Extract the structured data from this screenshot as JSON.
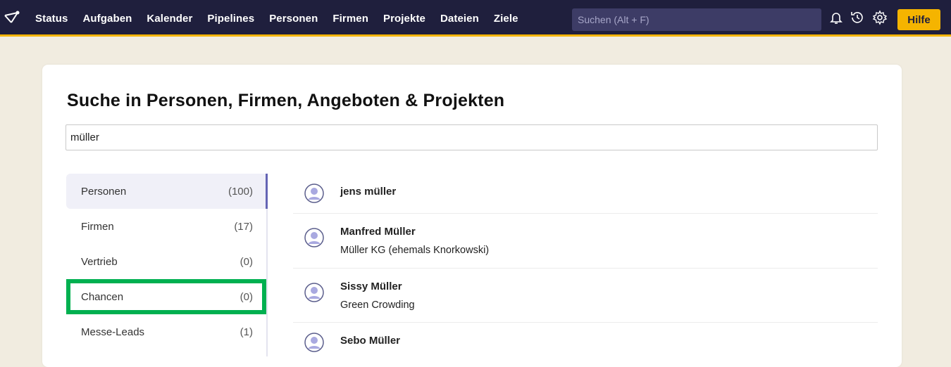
{
  "nav": {
    "items": [
      "Status",
      "Aufgaben",
      "Kalender",
      "Pipelines",
      "Personen",
      "Firmen",
      "Projekte",
      "Dateien",
      "Ziele"
    ],
    "search_placeholder": "Suchen (Alt + F)",
    "help_label": "Hilfe",
    "icons": [
      "bell-icon",
      "history-icon",
      "gear-icon"
    ]
  },
  "page": {
    "title": "Suche in Personen, Firmen, Angeboten & Projekten",
    "query": "müller"
  },
  "categories": [
    {
      "label": "Personen",
      "count": "(100)"
    },
    {
      "label": "Firmen",
      "count": "(17)"
    },
    {
      "label": "Vertrieb",
      "count": "(0)"
    },
    {
      "label": "Chancen",
      "count": "(0)"
    },
    {
      "label": "Messe-Leads",
      "count": "(1)"
    }
  ],
  "results": [
    {
      "name": "jens müller",
      "subtitle": ""
    },
    {
      "name": "Manfred Müller",
      "subtitle": "Müller KG (ehemals Knorkowski)"
    },
    {
      "name": "Sissy Müller",
      "subtitle": "Green Crowding"
    },
    {
      "name": "Sebo Müller",
      "subtitle": ""
    }
  ],
  "colors": {
    "nav_bg": "#1f1f3d",
    "accent": "#f5b400",
    "active_indicator": "#6464b4",
    "highlight_box": "#00b050"
  }
}
